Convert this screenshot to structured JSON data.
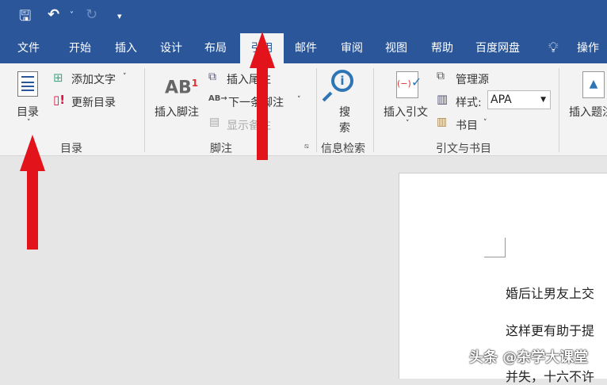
{
  "qat": {
    "save": "save-icon",
    "undo": "undo-icon",
    "redo": "redo-icon",
    "customize": "▾"
  },
  "tabs": [
    {
      "label": "文件"
    },
    {
      "label": "开始"
    },
    {
      "label": "插入"
    },
    {
      "label": "设计"
    },
    {
      "label": "布局"
    },
    {
      "label": "引用",
      "selected": true
    },
    {
      "label": "邮件"
    },
    {
      "label": "审阅"
    },
    {
      "label": "视图"
    },
    {
      "label": "帮助"
    },
    {
      "label": "百度网盘"
    }
  ],
  "tell_me": "操作说",
  "ribbon": {
    "toc": {
      "button": "目录",
      "add_text": "添加文字",
      "update": "更新目录",
      "group": "目录"
    },
    "footnotes": {
      "insert_footnote": "插入脚注",
      "insert_endnote": "插入尾注",
      "next_footnote": "下一条脚注",
      "show_notes": "显示备注",
      "group": "脚注"
    },
    "research": {
      "search1": "搜",
      "search2": "索",
      "group": "信息检索"
    },
    "citations": {
      "insert_citation": "插入引文",
      "manage_sources": "管理源",
      "style_label": "样式:",
      "style_value": "APA",
      "bibliography": "书目",
      "group": "引文与书目"
    },
    "captions": {
      "insert_caption": "插入题注"
    }
  },
  "document": {
    "lines": [
      "婚后让男友上交",
      "这样更有助于提",
      "并失，十六不许"
    ]
  },
  "watermark": "头条 @杂学大课堂",
  "colors": {
    "titlebar": "#2b579a",
    "ribbon": "#f3f3f3",
    "arrow": "#e3131b"
  }
}
